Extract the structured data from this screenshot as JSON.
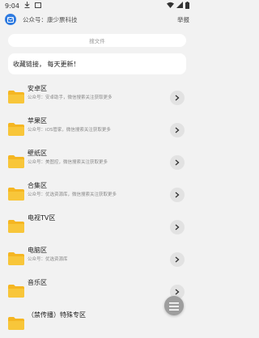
{
  "status_bar": {
    "time": "9:04"
  },
  "header": {
    "title": "公众号：康少票科技",
    "action_label": "举报"
  },
  "search": {
    "placeholder": "搜文件"
  },
  "notice": {
    "text": "收藏链接，   每天更新！"
  },
  "list": {
    "items": [
      {
        "title": "安卓区",
        "subtitle": "公众号：安卓助手，微信搜索关注获取更多"
      },
      {
        "title": "苹果区",
        "subtitle": "公众号：iOS管家，微信搜索关注获取更多"
      },
      {
        "title": "壁纸区",
        "subtitle": "公众号：美图控，微信搜索关注获取更多"
      },
      {
        "title": "合集区",
        "subtitle": "公众号：优选资源库，微信搜索关注获取更多"
      },
      {
        "title": "电视TV区",
        "subtitle": ""
      },
      {
        "title": "电脑区",
        "subtitle": "公众号：优选资源库"
      },
      {
        "title": "音乐区",
        "subtitle": ""
      },
      {
        "title": "（禁传播）特殊专区",
        "subtitle": ""
      }
    ]
  },
  "colors": {
    "accent": "#2f7be0",
    "folder": "#f5b622",
    "fab": "#9e9e9e"
  }
}
